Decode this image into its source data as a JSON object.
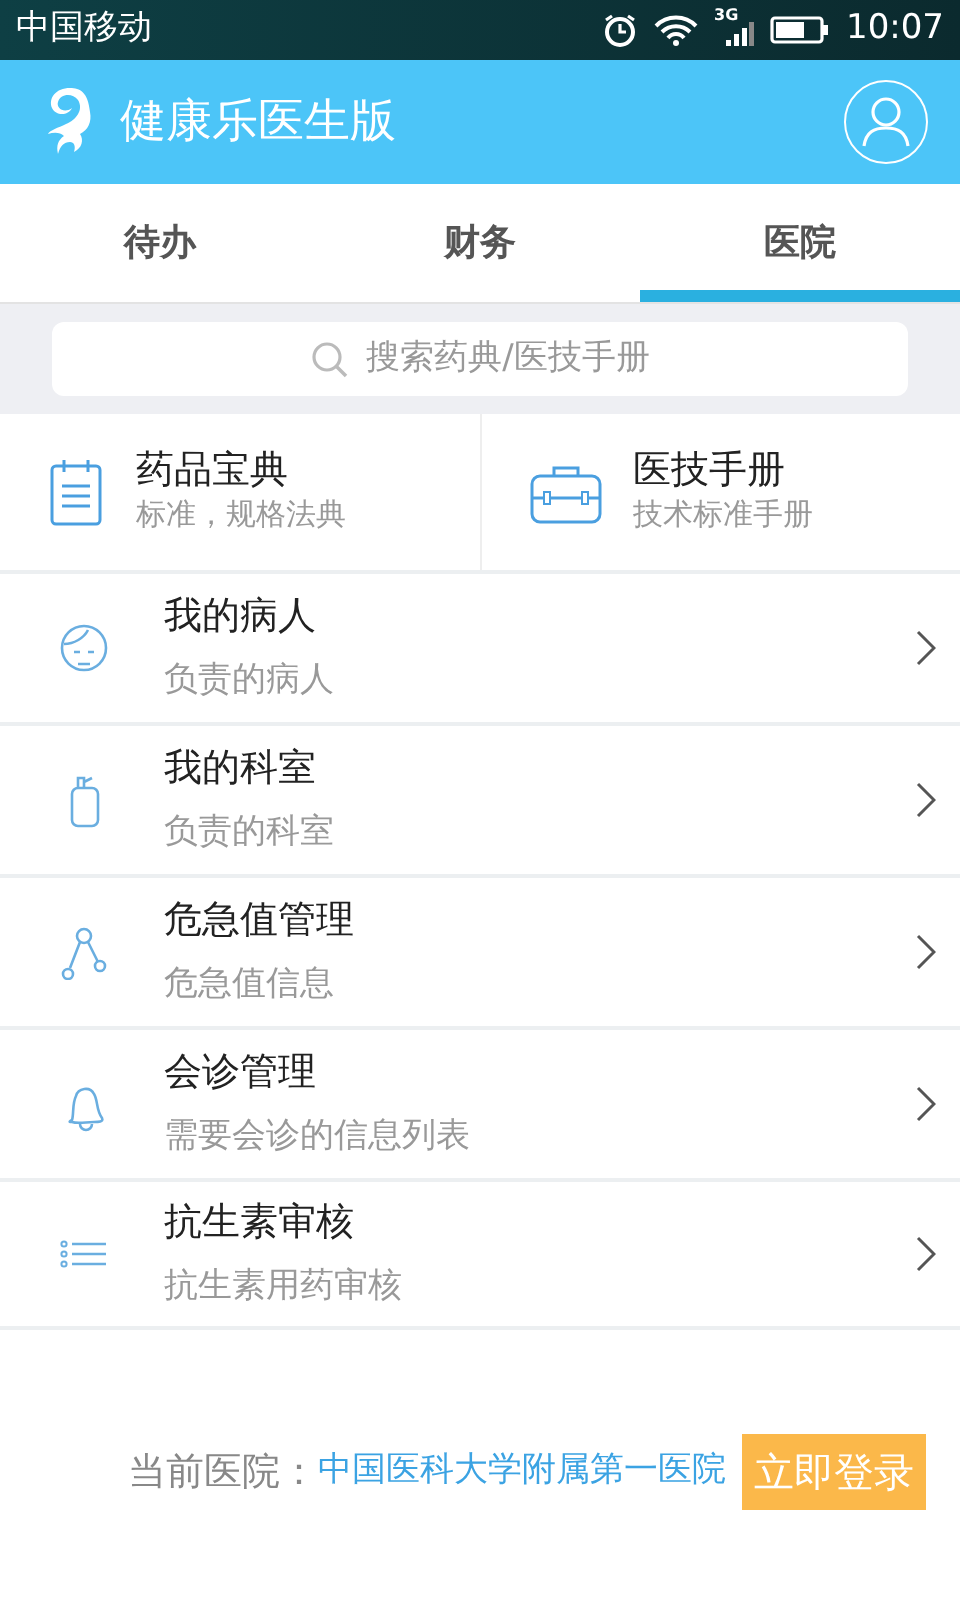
{
  "status_bar": {
    "carrier": "中国移动",
    "network": "3G",
    "time": "10:07"
  },
  "header": {
    "title": "健康乐医生版"
  },
  "tabs": [
    {
      "label": "待办",
      "selected": false
    },
    {
      "label": "财务",
      "selected": false
    },
    {
      "label": "医院",
      "selected": true
    }
  ],
  "search": {
    "placeholder": "搜索药典/医技手册"
  },
  "shortcuts": [
    {
      "title": "药品宝典",
      "subtitle": "标准，规格法典"
    },
    {
      "title": "医技手册",
      "subtitle": "技术标准手册"
    }
  ],
  "menu_items": [
    {
      "title": "我的病人",
      "subtitle": "负责的病人"
    },
    {
      "title": "我的科室",
      "subtitle": "负责的科室"
    },
    {
      "title": "危急值管理",
      "subtitle": "危急值信息"
    },
    {
      "title": "会诊管理",
      "subtitle": "需要会诊的信息列表"
    },
    {
      "title": "抗生素审核",
      "subtitle": "抗生素用药审核"
    }
  ],
  "footer": {
    "label": "当前医院：",
    "hospital": "中国医科大学附属第一医院",
    "login_button": "立即登录"
  }
}
